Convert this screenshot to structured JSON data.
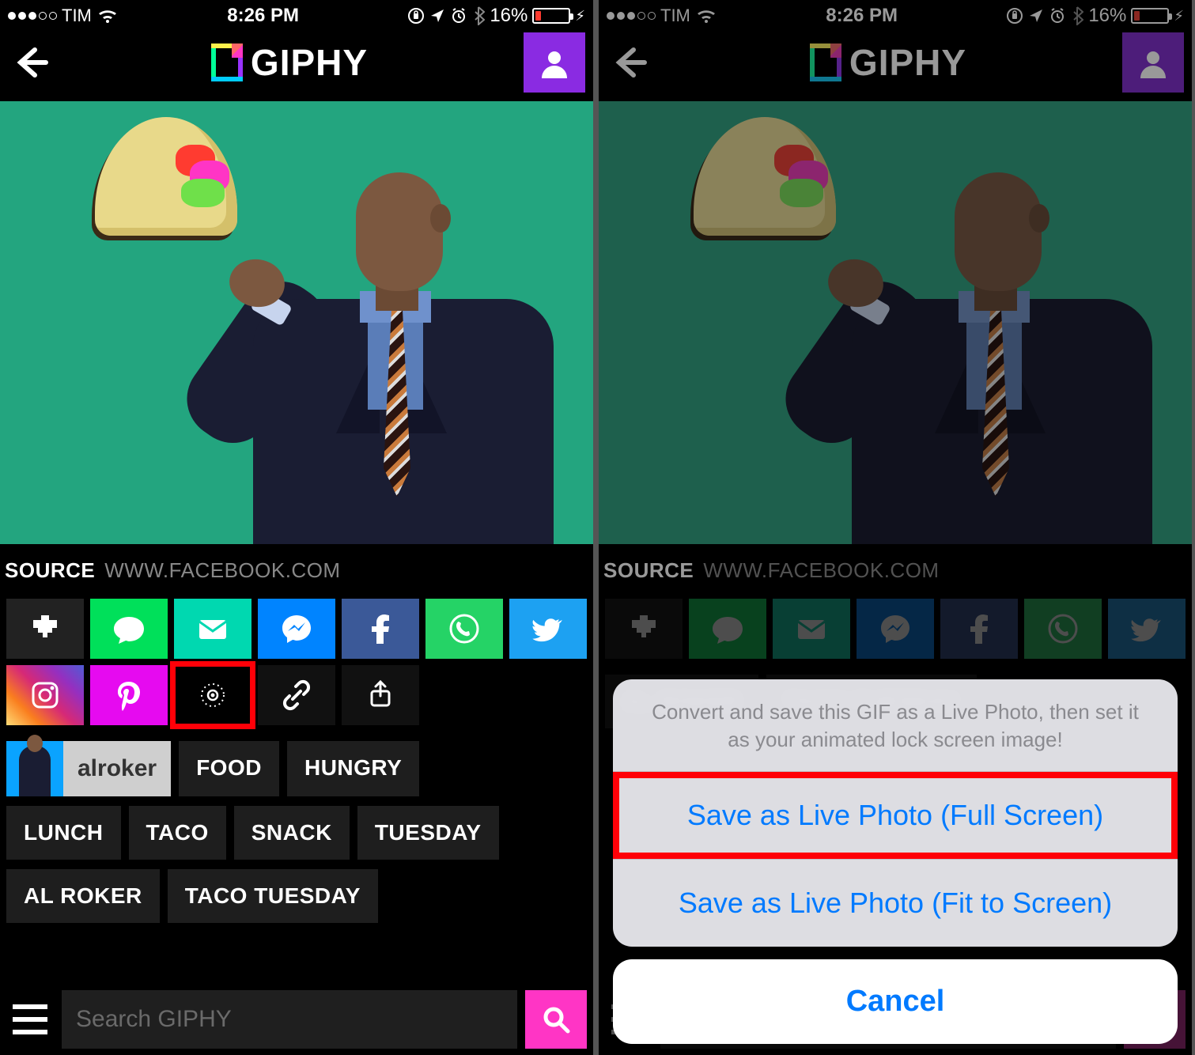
{
  "status": {
    "carrier": "TIM",
    "time": "8:26 PM",
    "battery_percent": "16%"
  },
  "nav": {
    "logo_text": "GIPHY"
  },
  "source": {
    "label": "SOURCE",
    "value": "WWW.FACEBOOK.COM"
  },
  "share": {
    "row1": [
      "heart",
      "sms",
      "mail",
      "messenger",
      "facebook",
      "whatsapp",
      "twitter"
    ],
    "row2": [
      "instagram",
      "pinterest",
      "livephoto",
      "link",
      "more"
    ]
  },
  "author": {
    "name": "alroker"
  },
  "tags_row1": [
    "FOOD",
    "HUNGRY"
  ],
  "tags_row2": [
    "LUNCH",
    "TACO",
    "SNACK",
    "TUESDAY"
  ],
  "tags_row3": [
    "AL ROKER",
    "TACO TUESDAY"
  ],
  "search": {
    "placeholder": "Search GIPHY"
  },
  "sheet": {
    "message": "Convert and save this GIF as a Live Photo, then set it as your animated lock screen image!",
    "option1": "Save as Live Photo (Full Screen)",
    "option2": "Save as Live Photo (Fit to Screen)",
    "cancel": "Cancel"
  }
}
